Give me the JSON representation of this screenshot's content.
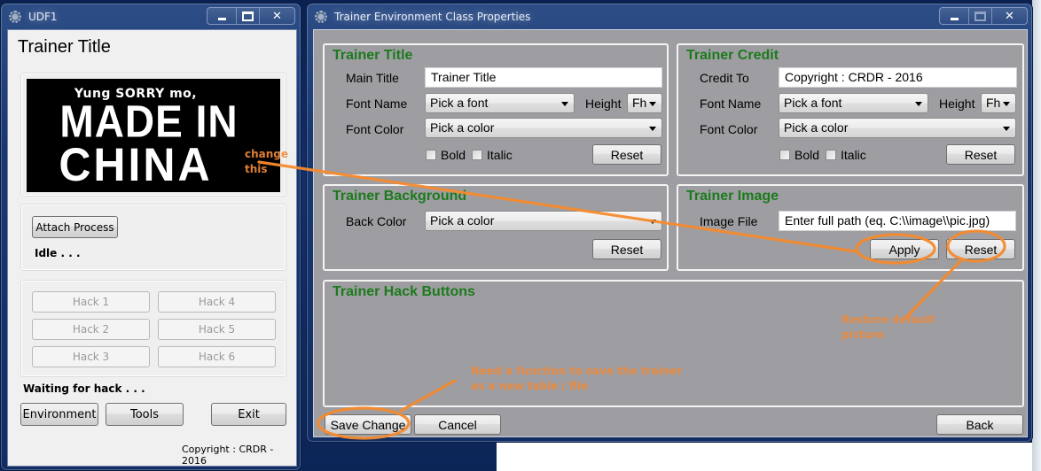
{
  "udf1": {
    "window_title": "UDF1",
    "caption_buttons": [
      "minimize",
      "maximize",
      "close"
    ],
    "trainer_title": "Trainer Title",
    "trainer_image": {
      "line1": "Yung SORRY mo,",
      "line2": "MADE IN",
      "line3": "CHINA"
    },
    "attach_process_label": "Attach Process",
    "process_status": "Idle . . .",
    "hack_buttons": [
      "Hack 1",
      "Hack 2",
      "Hack 3",
      "Hack 4",
      "Hack 5",
      "Hack 6"
    ],
    "hack_status": "Waiting for hack . . .",
    "environment_label": "Environment",
    "tools_label": "Tools",
    "exit_label": "Exit",
    "copyright": "Copyright : CRDR - 2016"
  },
  "props": {
    "window_title": "Trainer Environment Class Properties",
    "trainer_title_group": {
      "title": "Trainer Title",
      "main_title_label": "Main Title",
      "main_title_value": "Trainer Title",
      "font_name_label": "Font Name",
      "font_name_value": "Pick a font",
      "height_label": "Height",
      "height_value": "Fh",
      "font_color_label": "Font Color",
      "font_color_value": "Pick a color",
      "bold_label": "Bold",
      "bold_checked": false,
      "italic_label": "Italic",
      "italic_checked": false,
      "reset_label": "Reset"
    },
    "trainer_credit_group": {
      "title": "Trainer Credit",
      "credit_to_label": "Credit To",
      "credit_to_value": "Copyright : CRDR - 2016",
      "font_name_label": "Font Name",
      "font_name_value": "Pick a font",
      "height_label": "Height",
      "height_value": "Fh",
      "font_color_label": "Font Color",
      "font_color_value": "Pick a color",
      "bold_label": "Bold",
      "bold_checked": false,
      "italic_label": "Italic",
      "italic_checked": false,
      "reset_label": "Reset"
    },
    "trainer_background_group": {
      "title": "Trainer Background",
      "back_color_label": "Back Color",
      "back_color_value": "Pick a color",
      "reset_label": "Reset"
    },
    "trainer_image_group": {
      "title": "Trainer Image",
      "image_file_label": "Image File",
      "image_file_value": "Enter full path (eq. C:\\\\image\\\\pic.jpg)",
      "apply_label": "Apply",
      "reset_label": "Reset"
    },
    "trainer_hack_buttons_group": {
      "title": "Trainer Hack Buttons"
    },
    "save_change_label": "Save Change",
    "cancel_label": "Cancel",
    "back_label": "Back"
  },
  "annotations": {
    "color": "#f08a3a",
    "change_this": [
      "change",
      "this"
    ],
    "restore_default": [
      "Restore default",
      "picture"
    ],
    "save_function": [
      "Need a function to save the trainer",
      "as a new table / file"
    ]
  }
}
